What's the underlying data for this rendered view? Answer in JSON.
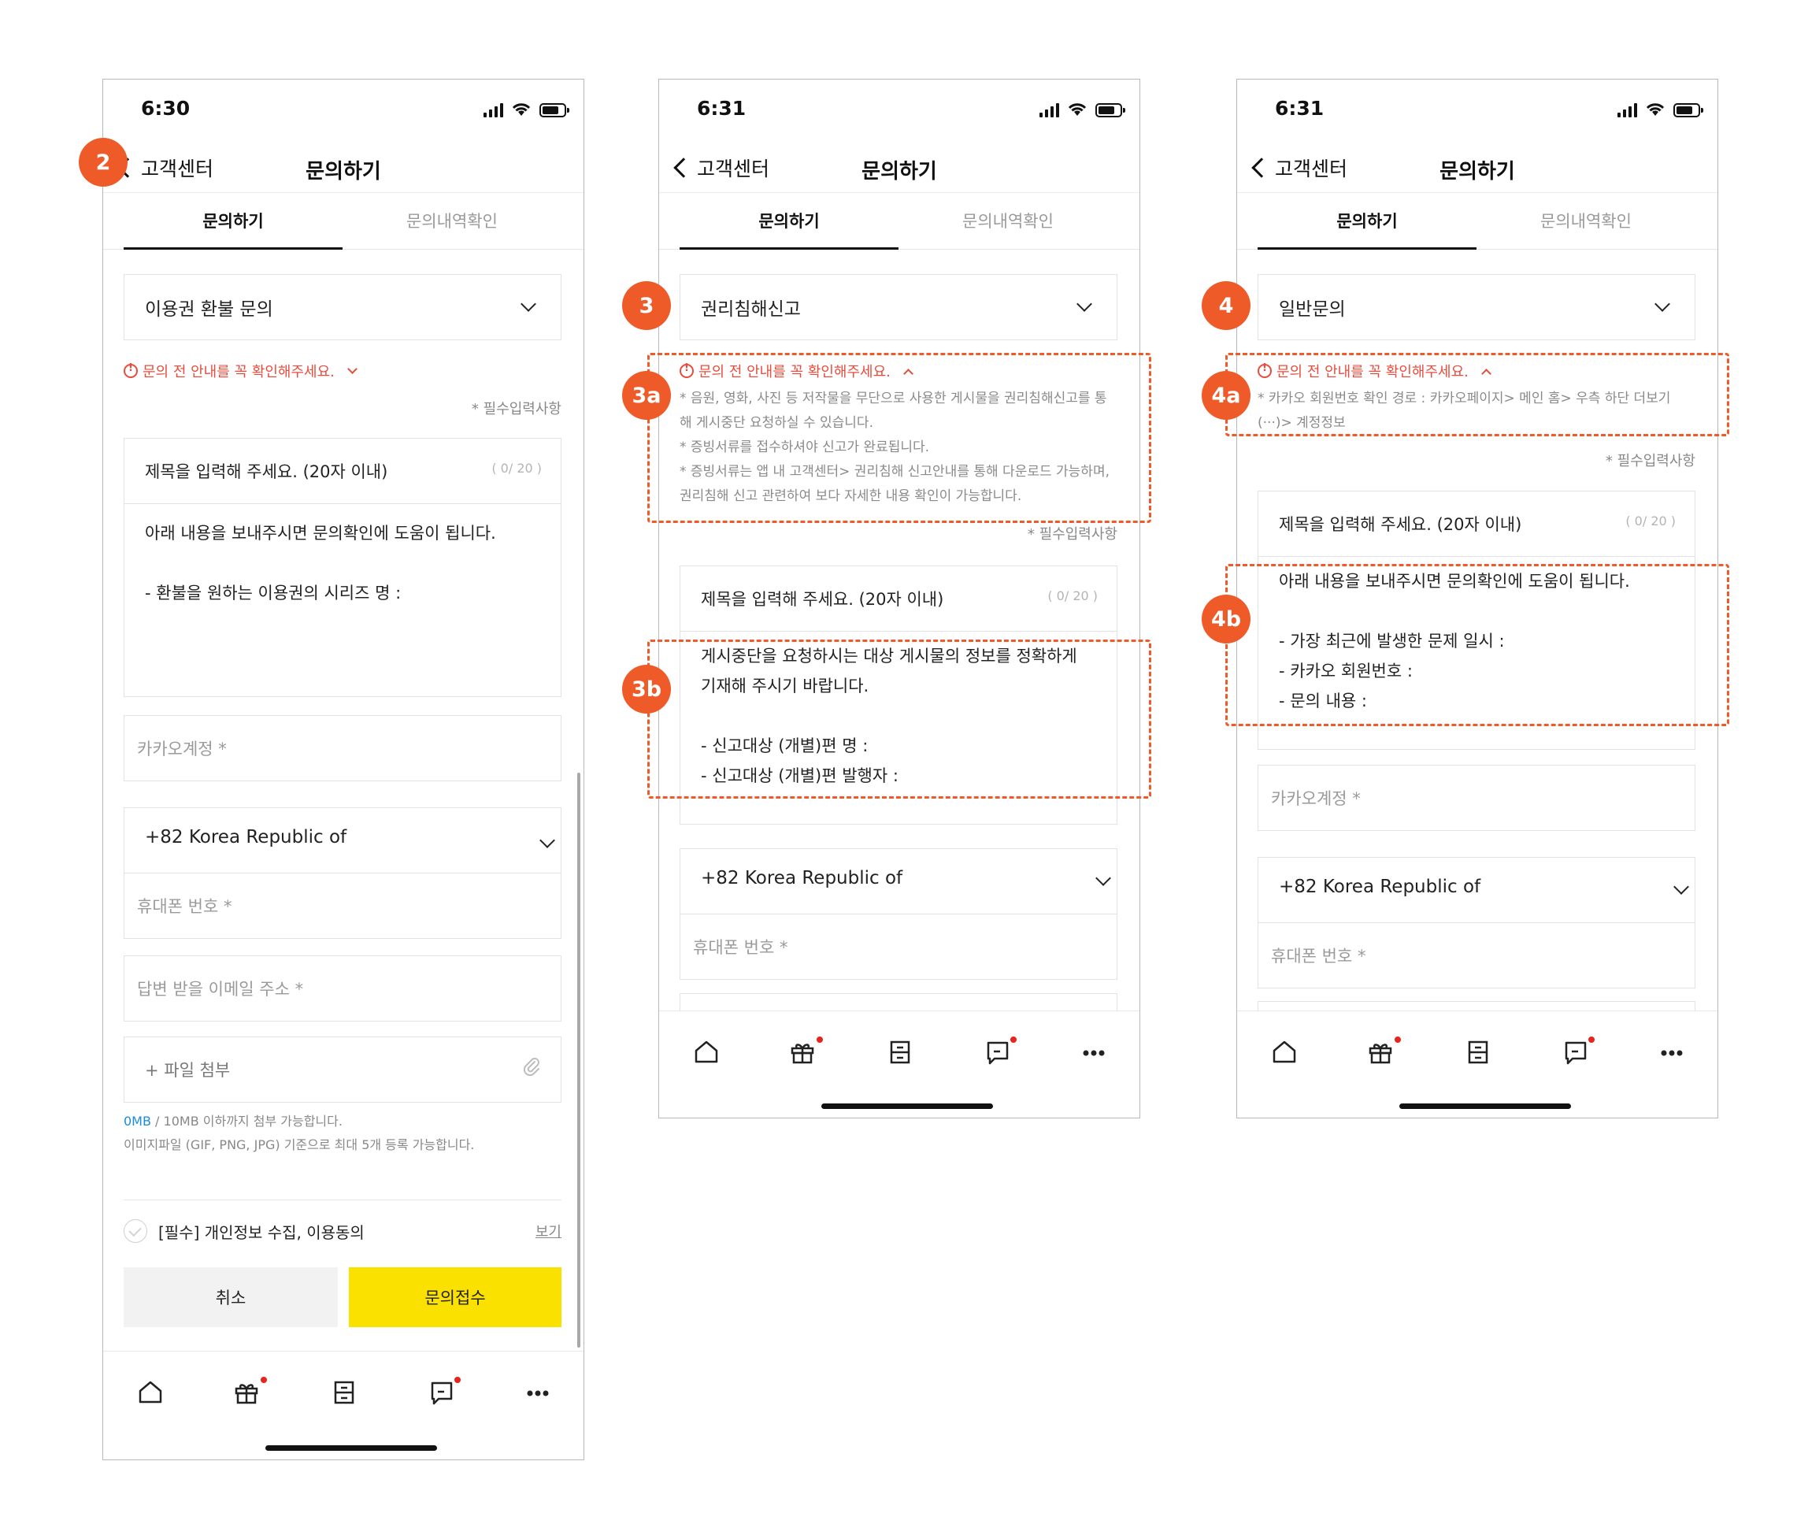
{
  "status": {
    "time1": "6:30",
    "time2": "6:31",
    "time3": "6:31"
  },
  "nav": {
    "back_label": "고객센터",
    "title": "문의하기"
  },
  "tabs": {
    "inquire": "문의하기",
    "history": "문의내역확인"
  },
  "screen1": {
    "category": "이용권 환불 문의",
    "notice_toggle": "문의 전 안내를 꼭 확인해주세요.",
    "required_note": "* 필수입력사항",
    "title_placeholder": "제목을 입력해 주세요. (20자 이내)",
    "counter": "( 0/ 20 )",
    "body_text": "아래 내용을 보내주시면 문의확인에 도움이 됩니다.\n\n- 환불을 원하는 이용권의 시리즈 명 :",
    "kakao_account": "카카오계정 *",
    "country_code": "+82 Korea Republic of",
    "phone": "휴대폰 번호 *",
    "email": "답변 받을 이메일 주소 *",
    "attach": "+ 파일 첨부",
    "file_size": "0MB",
    "file_limit": " / 10MB 이하까지 첨부 가능합니다.",
    "file_types": "이미지파일 (GIF, PNG, JPG) 기준으로 최대 5개 등록 가능합니다.",
    "agree_text": "[필수] 개인정보 수집, 이용동의",
    "view_link": "보기",
    "cancel": "취소",
    "submit": "문의접수"
  },
  "screen2": {
    "category": "권리침해신고",
    "notice_toggle": "문의 전 안내를 꼭 확인해주세요.",
    "notice_1": "* 음원, 영화, 사진 등 저작물을 무단으로 사용한 게시물을 권리침해신고를 통해 게시중단 요청하실 수 있습니다.",
    "notice_2": "* 증빙서류를 접수하셔야 신고가 완료됩니다.",
    "notice_3": "* 증빙서류는 앱 내 고객센터> 권리침해 신고안내를 통해 다운로드 가능하며, 권리침해 신고 관련하여 보다 자세한 내용 확인이 가능합니다.",
    "required_note": "* 필수입력사항",
    "title_placeholder": "제목을 입력해 주세요. (20자 이내)",
    "counter": "( 0/ 20 )",
    "body_text": "게시중단을 요청하시는 대상 게시물의 정보를 정확하게\n기재해 주시기 바랍니다.\n\n- 신고대상 (개별)편 명 :\n- 신고대상 (개별)편 발행자 :",
    "country_code": "+82 Korea Republic of",
    "phone": "휴대폰 번호 *"
  },
  "screen3": {
    "category": "일반문의",
    "notice_toggle": "문의 전 안내를 꼭 확인해주세요.",
    "notice_1": "* 카카오 회원번호 확인 경로 : 카카오페이지> 메인 홈> 우측 하단 더보기(···)> 계정정보",
    "required_note": "* 필수입력사항",
    "title_placeholder": "제목을 입력해 주세요. (20자 이내)",
    "counter": "( 0/ 20 )",
    "body_text": "아래 내용을 보내주시면 문의확인에 도움이 됩니다.\n\n- 가장 최근에 발생한 문제 일시 :\n- 카카오 회원번호 :\n- 문의 내용 :",
    "kakao_account": "카카오계정 *",
    "country_code": "+82 Korea Republic of",
    "phone": "휴대폰 번호 *"
  },
  "annotations": {
    "b2": "2",
    "b3": "3",
    "b3a": "3a",
    "b3b": "3b",
    "b4": "4",
    "b4a": "4a",
    "b4b": "4b"
  },
  "bottom_nav_icons": [
    "home-icon",
    "gift-icon",
    "bookshelf-icon",
    "message-icon",
    "more-icon"
  ],
  "colors": {
    "accent_yellow": "#fae100",
    "notice_red": "#e84c3d",
    "annotation_orange": "#ef5b28",
    "badge_dot": "#e8241c"
  }
}
